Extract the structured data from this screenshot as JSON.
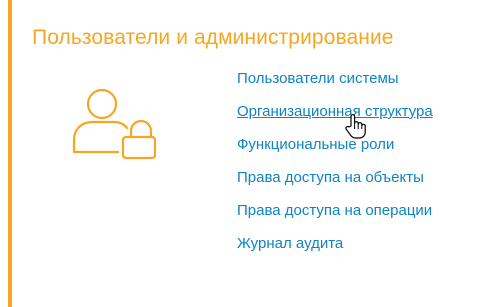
{
  "section": {
    "title": "Пользователи и администрирование",
    "icon": "user-lock-icon",
    "accent_color": "#f5a623"
  },
  "links": [
    {
      "label": "Пользователи системы",
      "hovered": false
    },
    {
      "label": "Организационная структура",
      "hovered": true
    },
    {
      "label": "Функциональные роли",
      "hovered": false
    },
    {
      "label": "Права доступа на объекты",
      "hovered": false
    },
    {
      "label": "Права доступа на операции",
      "hovered": false
    },
    {
      "label": "Журнал аудита",
      "hovered": false
    }
  ],
  "link_color": "#0e84c4",
  "cursor": "hand-pointer-icon"
}
